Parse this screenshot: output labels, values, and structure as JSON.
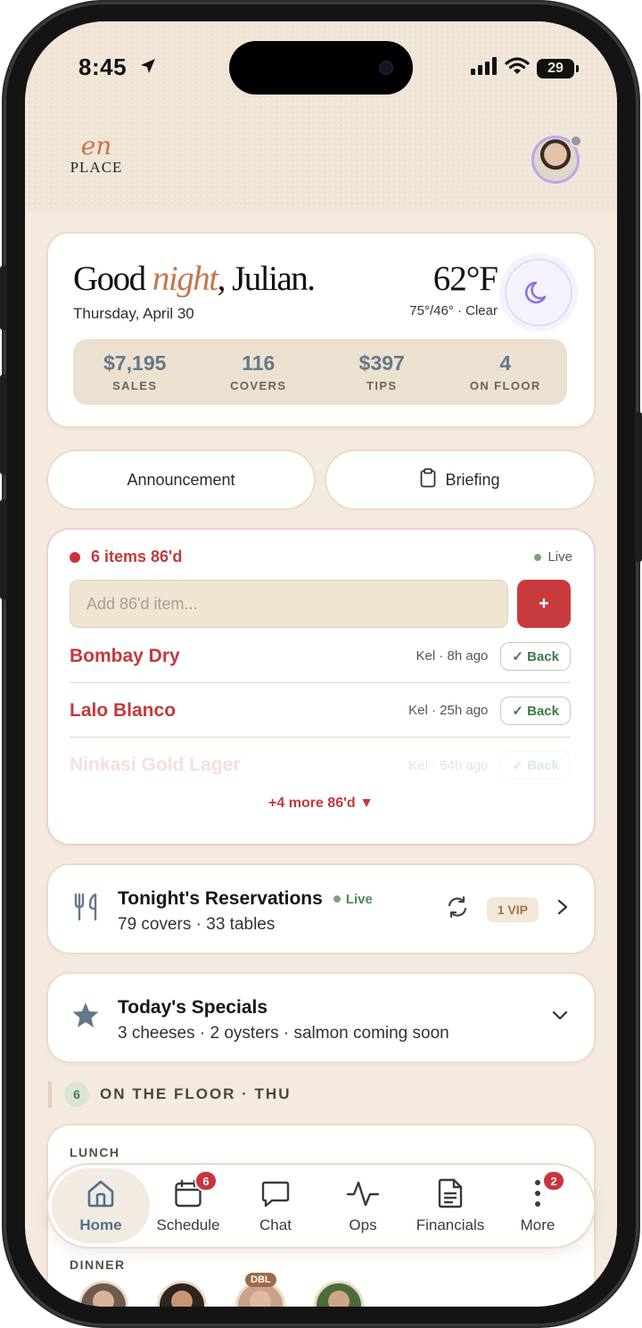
{
  "status": {
    "time": "8:45",
    "battery": "29"
  },
  "header": {
    "logo_top": "en",
    "logo_bottom": "PLACE"
  },
  "greeting": {
    "prefix": "Good ",
    "accent": "night",
    "suffix": ", Julian.",
    "date": "Thursday, April 30",
    "temperature": "62°F",
    "weather": "75°/46° · Clear",
    "stats": [
      {
        "value": "$7,195",
        "label": "SALES"
      },
      {
        "value": "116",
        "label": "COVERS"
      },
      {
        "value": "$397",
        "label": "TIPS"
      },
      {
        "value": "4",
        "label": "ON FLOOR"
      }
    ]
  },
  "actions": {
    "announcement": "Announcement",
    "briefing": "Briefing"
  },
  "eighty_six": {
    "title": "6 items 86'd",
    "live": "Live",
    "input_placeholder": "Add 86'd item...",
    "add_label": "+",
    "items": [
      {
        "name": "Bombay Dry",
        "meta": "Kel · 8h ago",
        "action": "✓ Back"
      },
      {
        "name": "Lalo Blanco",
        "meta": "Kel · 25h ago",
        "action": "✓ Back"
      },
      {
        "name": "Ninkasi Gold Lager",
        "meta": "Kel · 54h ago",
        "action": "✓ Back"
      }
    ],
    "more": "+4 more 86'd ▼"
  },
  "reservations": {
    "title": "Tonight's Reservations",
    "live": "Live",
    "subtitle": "79 covers · 33 tables",
    "vip": "1 VIP"
  },
  "specials": {
    "title": "Today's Specials",
    "subtitle": "3 cheeses · 2 oysters · salmon coming soon"
  },
  "floor": {
    "count": "6",
    "title": "ON THE FLOOR · THU",
    "lunch_label": "LUNCH",
    "dinner_label": "DINNER",
    "dbl_badge": "DBL"
  },
  "tabbar": {
    "items": [
      {
        "label": "Home",
        "icon": "home-icon",
        "badge": ""
      },
      {
        "label": "Schedule",
        "icon": "calendar-icon",
        "badge": "6"
      },
      {
        "label": "Chat",
        "icon": "chat-icon",
        "badge": ""
      },
      {
        "label": "Ops",
        "icon": "pulse-icon",
        "badge": ""
      },
      {
        "label": "Financials",
        "icon": "document-icon",
        "badge": ""
      },
      {
        "label": "More",
        "icon": "more-vertical-icon",
        "badge": "2"
      }
    ]
  },
  "colors": {
    "accent": "#c8754f",
    "alert_red": "#c83b3c",
    "slate": "#65788a",
    "live_green": "#7aa57c",
    "background": "#f4eadf"
  }
}
